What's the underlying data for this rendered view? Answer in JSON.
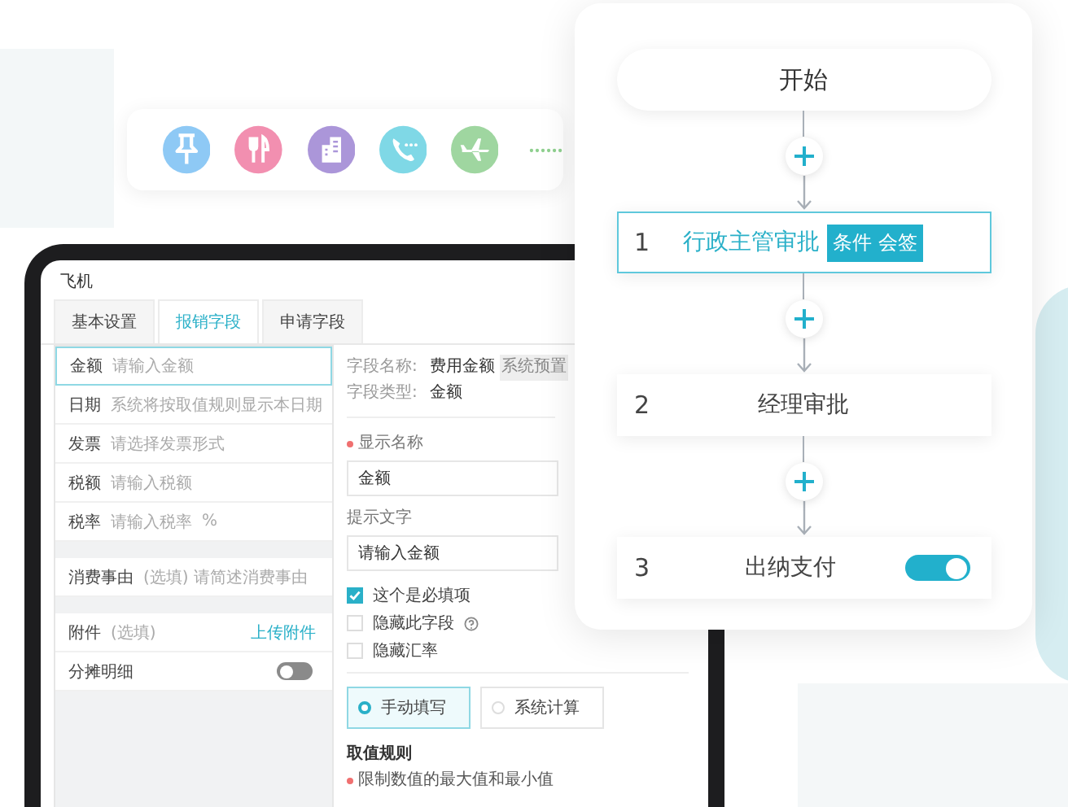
{
  "icon_bar": {
    "icons": [
      {
        "kind": "pin",
        "color": "#8ec9f5"
      },
      {
        "kind": "dining",
        "color": "#f28fb0"
      },
      {
        "kind": "building",
        "color": "#ab96d9"
      },
      {
        "kind": "phone",
        "color": "#7fd8e6"
      },
      {
        "kind": "plane",
        "color": "#9fd6a0"
      }
    ]
  },
  "tablet": {
    "title": "飞机",
    "tabs": [
      {
        "label": "基本设置",
        "selected": false
      },
      {
        "label": "报销字段",
        "selected": true
      },
      {
        "label": "申请字段",
        "selected": false
      }
    ],
    "field_groups": [
      [
        {
          "kind": "input",
          "label": "金额",
          "placeholder": "请输入金额",
          "selected": true
        },
        {
          "kind": "input",
          "label": "日期",
          "placeholder": "系统将按取值规则显示本日期",
          "selected": false
        },
        {
          "kind": "input",
          "label": "发票",
          "placeholder": "请选择发票形式",
          "selected": false
        },
        {
          "kind": "input",
          "label": "税额",
          "placeholder": "请输入税额",
          "selected": false
        },
        {
          "kind": "input",
          "label": "税率",
          "placeholder": "请输入税率",
          "suffix": "%",
          "selected": false
        }
      ],
      [
        {
          "kind": "input",
          "label": "消费事由",
          "placeholder": "(选填) 请简述消费事由",
          "selected": false
        }
      ],
      [
        {
          "kind": "link",
          "label": "附件",
          "note": "(选填)",
          "link": "上传附件",
          "selected": false
        },
        {
          "kind": "toggle",
          "label": "分摊明细",
          "on": false,
          "selected": false
        }
      ]
    ],
    "detail": {
      "name_label": "字段名称:",
      "name": "费用金额",
      "name_tag": "系统预置",
      "type_label": "字段类型:",
      "type": "金额",
      "display_name": {
        "label": "显示名称",
        "required": true,
        "value": "金额"
      },
      "hint": {
        "label": "提示文字",
        "required": false,
        "value": "请输入金额"
      },
      "options": [
        {
          "label": "这个是必填项",
          "checked": true,
          "help": false
        },
        {
          "label": "隐藏此字段",
          "checked": false,
          "help": true
        },
        {
          "label": "隐藏汇率",
          "checked": false,
          "help": false
        }
      ],
      "modes": [
        {
          "label": "手动填写",
          "selected": true
        },
        {
          "label": "系统计算",
          "selected": false
        }
      ],
      "rule_title": "取值规则",
      "rule": {
        "required": true,
        "text": "限制数值的最大值和最小值"
      }
    }
  },
  "flow": {
    "start": "开始",
    "nodes": [
      {
        "number": "1",
        "title": "行政主管审批",
        "tag": "条件 会签",
        "selected": true
      },
      {
        "number": "2",
        "title": "经理审批",
        "selected": false
      },
      {
        "number": "3",
        "title": "出纳支付",
        "selected": false,
        "toggle": {
          "on": true
        }
      }
    ]
  }
}
